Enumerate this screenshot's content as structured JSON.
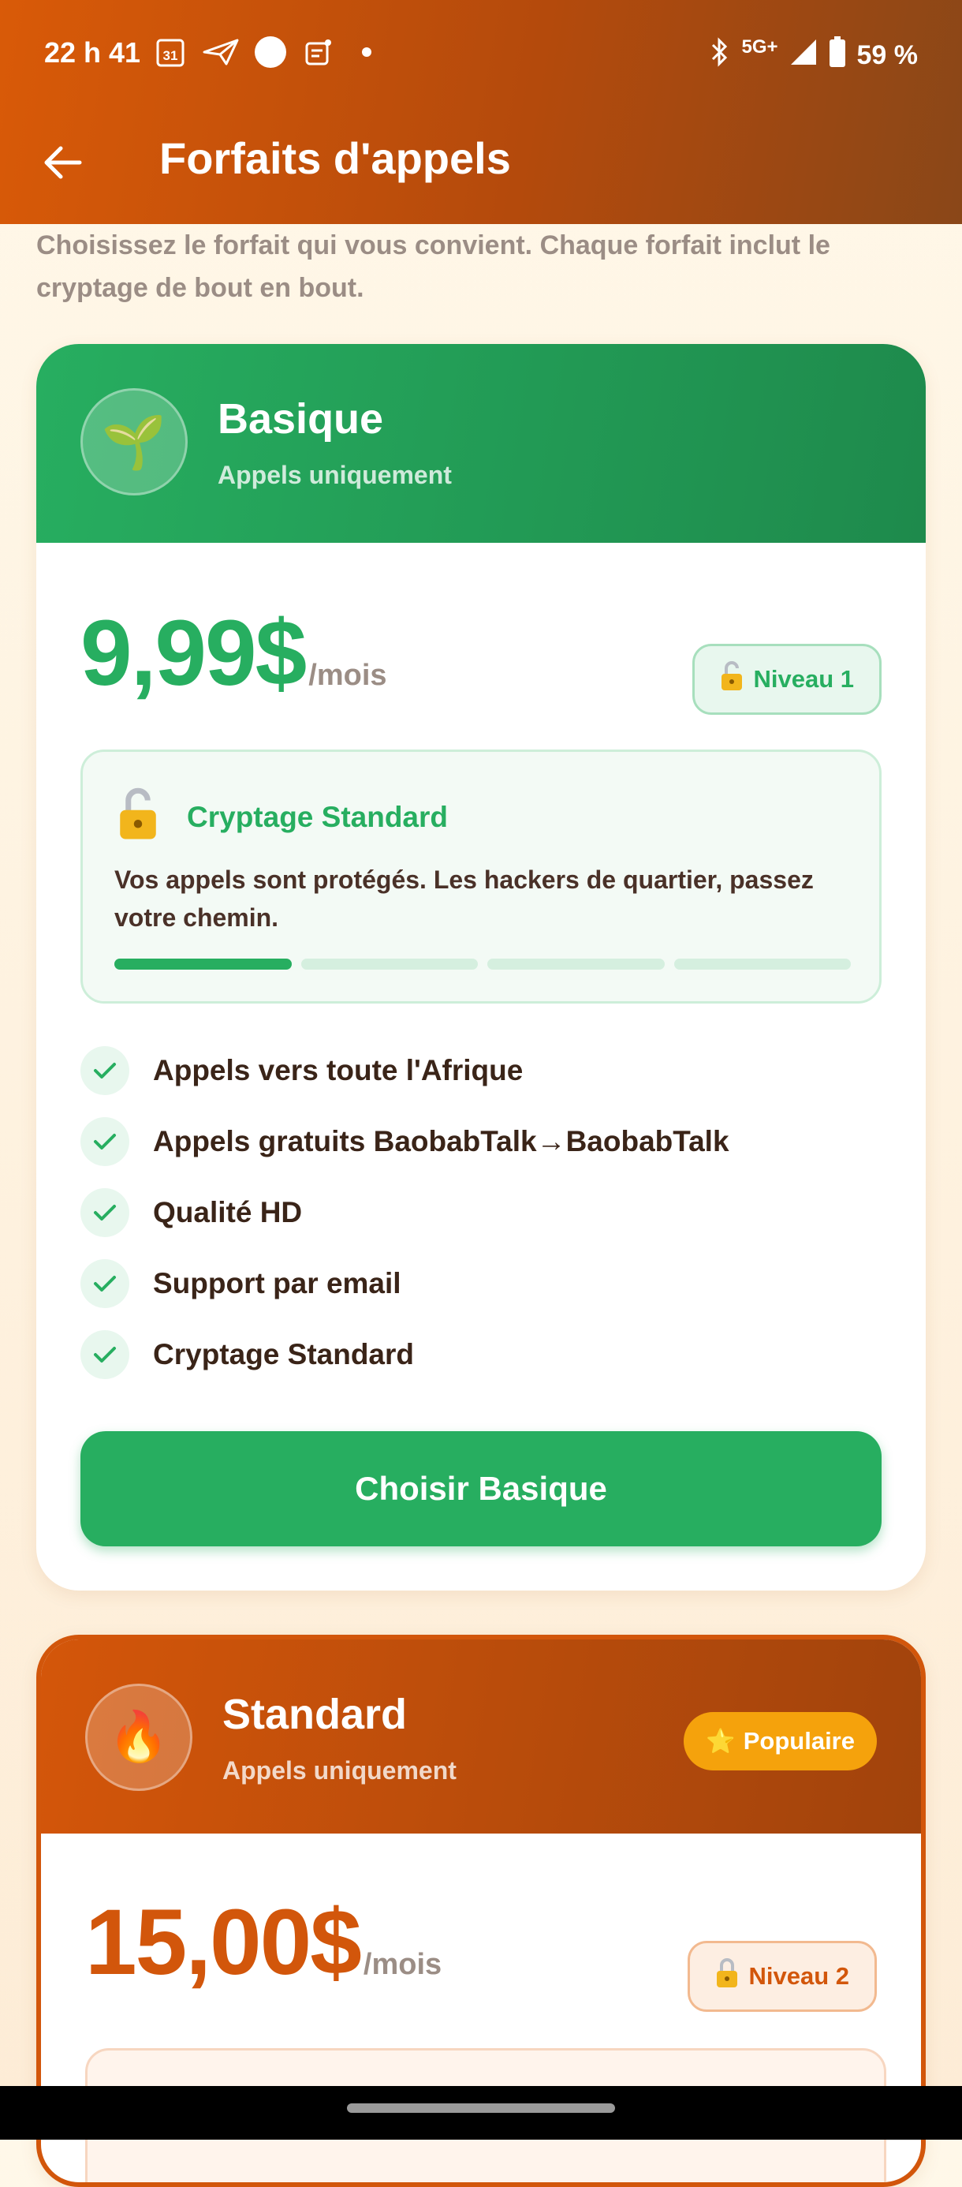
{
  "status_bar": {
    "time": "22 h 41",
    "calendar_day": "31",
    "network": "5G+",
    "battery": "59 %"
  },
  "header": {
    "title": "Forfaits d'appels"
  },
  "intro": "Choisissez le forfait qui vous convient. Chaque forfait inclut le cryptage de bout en bout.",
  "plans": [
    {
      "name": "Basique",
      "subtitle": "Appels uniquement",
      "emoji": "🌱",
      "icon": "seedling-icon",
      "price": "9,99$",
      "period": "/mois",
      "level": "Niveau 1",
      "encryption": {
        "title": "Cryptage Standard",
        "description": "Vos appels sont protégés. Les hackers de quartier, passez votre chemin.",
        "strength": 1,
        "max": 4
      },
      "features": [
        "Appels vers toute l'Afrique",
        "Appels gratuits BaobabTalk→BaobabTalk",
        "Qualité HD",
        "Support par email",
        "Cryptage Standard"
      ],
      "cta": "Choisir Basique",
      "color": "#27ae60"
    },
    {
      "name": "Standard",
      "subtitle": "Appels uniquement",
      "emoji": "🔥",
      "icon": "fire-icon",
      "badge": "Populaire",
      "price": "15,00$",
      "period": "/mois",
      "level": "Niveau 2",
      "color": "#d2560b"
    }
  ]
}
